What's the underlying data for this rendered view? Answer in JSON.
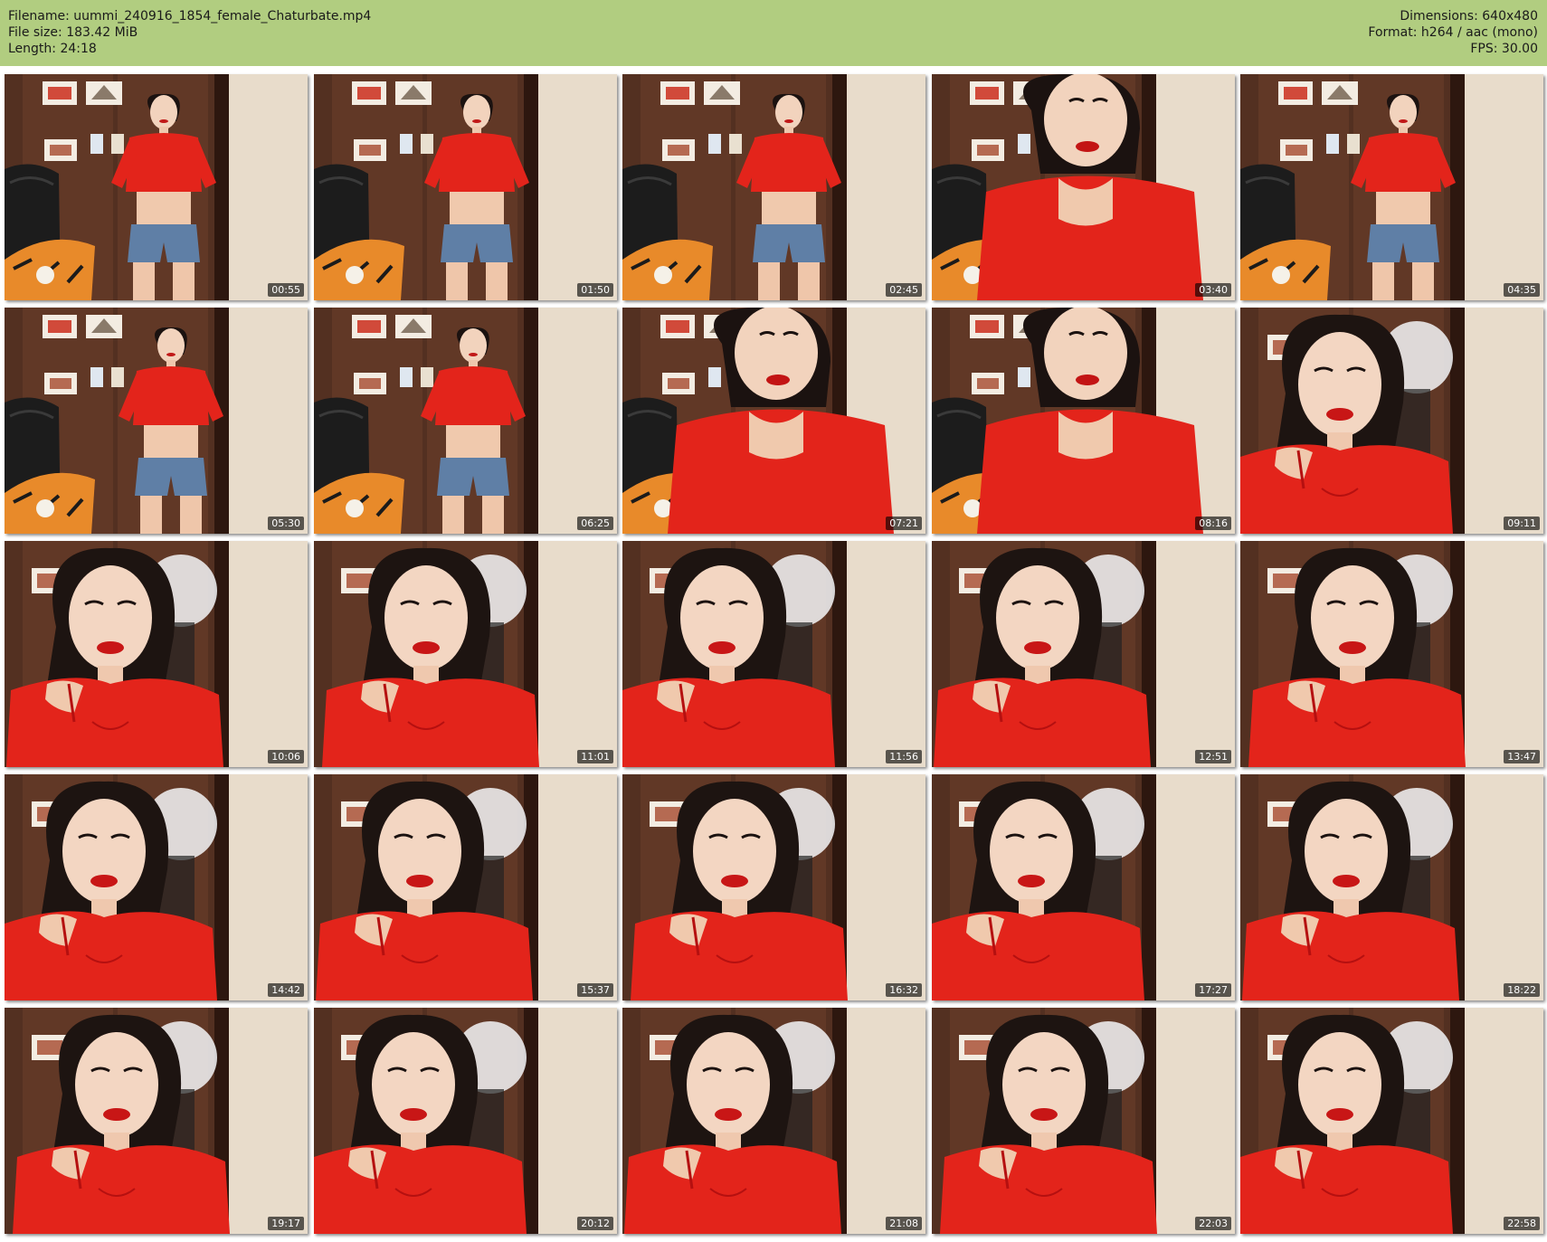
{
  "header": {
    "filename": "Filename: uummi_240916_1854_female_Chaturbate.mp4",
    "filesize": "File size: 183.42 MiB",
    "length": "Length: 24:18",
    "dimensions": "Dimensions: 640x480",
    "format": "Format: h264 / aac (mono)",
    "fps": "FPS: 30.00"
  },
  "colors": {
    "header_bg": "#b1cd80",
    "shirt_red": "#e3241b",
    "wall": "#e8dccb",
    "cabinet": "#5a3424"
  },
  "thumbnails": [
    {
      "time": "00:55",
      "scene": "wide"
    },
    {
      "time": "01:50",
      "scene": "wide"
    },
    {
      "time": "02:45",
      "scene": "wide"
    },
    {
      "time": "03:40",
      "scene": "lean"
    },
    {
      "time": "04:35",
      "scene": "wide"
    },
    {
      "time": "05:30",
      "scene": "wide"
    },
    {
      "time": "06:25",
      "scene": "wide"
    },
    {
      "time": "07:21",
      "scene": "lean"
    },
    {
      "time": "08:16",
      "scene": "lean"
    },
    {
      "time": "09:11",
      "scene": "close"
    },
    {
      "time": "10:06",
      "scene": "close"
    },
    {
      "time": "11:01",
      "scene": "close"
    },
    {
      "time": "11:56",
      "scene": "close"
    },
    {
      "time": "12:51",
      "scene": "close"
    },
    {
      "time": "13:47",
      "scene": "close"
    },
    {
      "time": "14:42",
      "scene": "close"
    },
    {
      "time": "15:37",
      "scene": "close"
    },
    {
      "time": "16:32",
      "scene": "close"
    },
    {
      "time": "17:27",
      "scene": "close"
    },
    {
      "time": "18:22",
      "scene": "close"
    },
    {
      "time": "19:17",
      "scene": "close"
    },
    {
      "time": "20:12",
      "scene": "close"
    },
    {
      "time": "21:08",
      "scene": "close"
    },
    {
      "time": "22:03",
      "scene": "close"
    },
    {
      "time": "22:58",
      "scene": "close"
    }
  ]
}
